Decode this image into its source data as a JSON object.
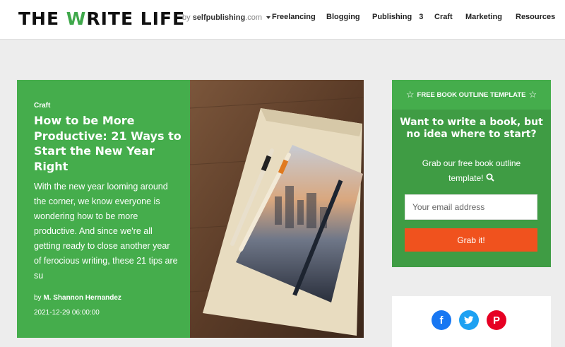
{
  "header": {
    "logo_part1": "THE ",
    "logo_w": "W",
    "logo_part2": "RITE LIFE",
    "by_prefix": "by",
    "by_site": "selfpublishing",
    "by_tld": ".com",
    "nav": [
      {
        "label": "Freelancing"
      },
      {
        "label": "Blogging"
      },
      {
        "label": "Publishing",
        "badge": "3"
      },
      {
        "label": "Craft"
      },
      {
        "label": "Marketing"
      },
      {
        "label": "Resources"
      }
    ]
  },
  "featured": {
    "category": "Craft",
    "title": "How to be More Productive: 21 Ways to Start the New Year Right",
    "excerpt": "With the new year looming around the corner, we know everyone is wondering how to be more productive. And since we're all getting ready to close another year of ferocious writing, these 21 tips are su",
    "author_prefix": "by",
    "author": "M. Shannon Hernandez",
    "date": "2021-12-29 06:00:00"
  },
  "widget": {
    "header": "FREE BOOK OUTLINE TEMPLATE",
    "title": "Want to write a book, but no idea where to start?",
    "subtitle": "Grab our free book outline template!",
    "email_placeholder": "Your email address",
    "button": "Grab it!"
  },
  "social": {
    "icons": [
      "facebook-icon",
      "twitter-icon",
      "pinterest-icon"
    ],
    "colors": {
      "facebook": "#1877f2",
      "twitter": "#1da1f2",
      "pinterest": "#e60023"
    }
  },
  "colors": {
    "brand_green": "#45ad4c",
    "accent_orange": "#f0521e"
  }
}
